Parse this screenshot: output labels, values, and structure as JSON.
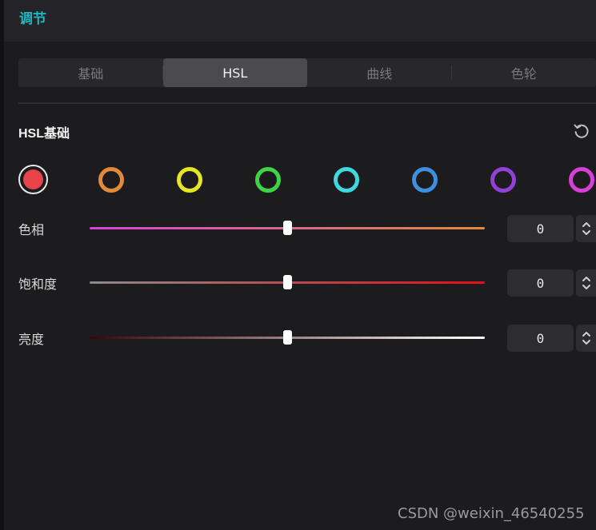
{
  "header": {
    "title": "调节"
  },
  "tabs": [
    {
      "label": "基础",
      "active": false
    },
    {
      "label": "HSL",
      "active": true
    },
    {
      "label": "曲线",
      "active": false
    },
    {
      "label": "色轮",
      "active": false
    }
  ],
  "section": {
    "title": "HSL基础",
    "reset_icon": "reset-icon"
  },
  "swatches": [
    {
      "name": "red",
      "color": "#e8434a",
      "selected": true
    },
    {
      "name": "orange",
      "color": "#e08a3c",
      "selected": false
    },
    {
      "name": "yellow",
      "color": "#e6e623",
      "selected": false
    },
    {
      "name": "green",
      "color": "#3fd345",
      "selected": false
    },
    {
      "name": "cyan",
      "color": "#3ed9df",
      "selected": false
    },
    {
      "name": "blue",
      "color": "#3f8fe0",
      "selected": false
    },
    {
      "name": "purple",
      "color": "#9140d8",
      "selected": false
    },
    {
      "name": "magenta",
      "color": "#d83fd8",
      "selected": false
    }
  ],
  "sliders": [
    {
      "label": "色相",
      "value": "0",
      "position": 0.5,
      "track_colors": [
        "#d444d8",
        "#e08a3c"
      ]
    },
    {
      "label": "饱和度",
      "value": "0",
      "position": 0.5,
      "track_colors": [
        "#8a8a8a",
        "#e0101a"
      ]
    },
    {
      "label": "亮度",
      "value": "0",
      "position": 0.5,
      "track_colors": [
        "#3a0505",
        "#ffffff"
      ]
    }
  ],
  "watermark": "CSDN @weixin_46540255"
}
